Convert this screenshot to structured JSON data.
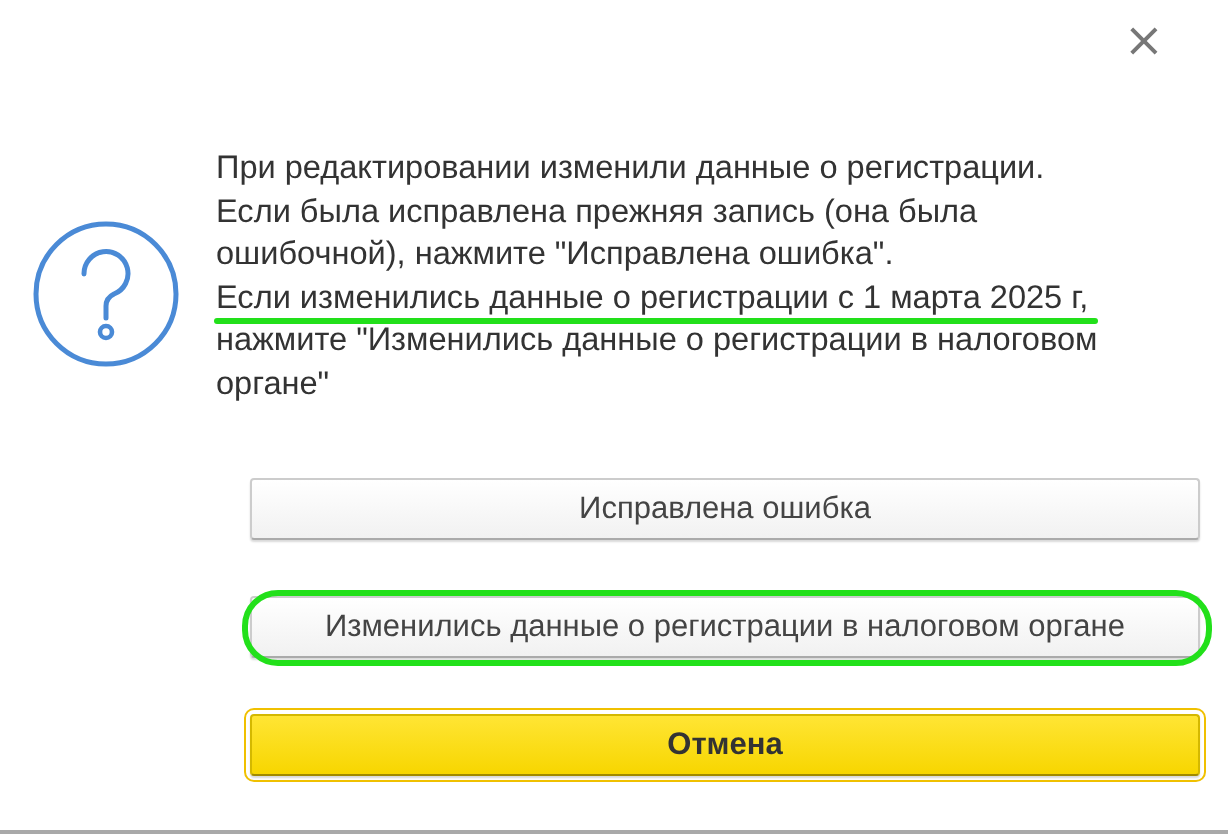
{
  "close_button": "×",
  "message_lines": [
    {
      "text": "При редактировании изменили данные о регистрации.",
      "highlighted": false
    },
    {
      "text": "Если была исправлена прежняя запись (она была",
      "highlighted": false
    },
    {
      "text": "ошибочной), нажмите \"Исправлена ошибка\".",
      "highlighted": false
    },
    {
      "text": "Если изменились данные о регистрации с 1 марта 2025 г,",
      "highlighted": true
    },
    {
      "text": "нажмите \"Изменились данные о регистрации в налоговом",
      "highlighted": false
    },
    {
      "text": "органе\"",
      "highlighted": false
    }
  ],
  "buttons": [
    {
      "label": "Исправлена ошибка",
      "kind": "default",
      "highlighted": false,
      "focused": false
    },
    {
      "label": "Изменились данные о регистрации в налоговом органе",
      "kind": "default",
      "highlighted": true,
      "focused": false
    },
    {
      "label": "Отмена",
      "kind": "primary",
      "highlighted": false,
      "focused": true
    }
  ]
}
